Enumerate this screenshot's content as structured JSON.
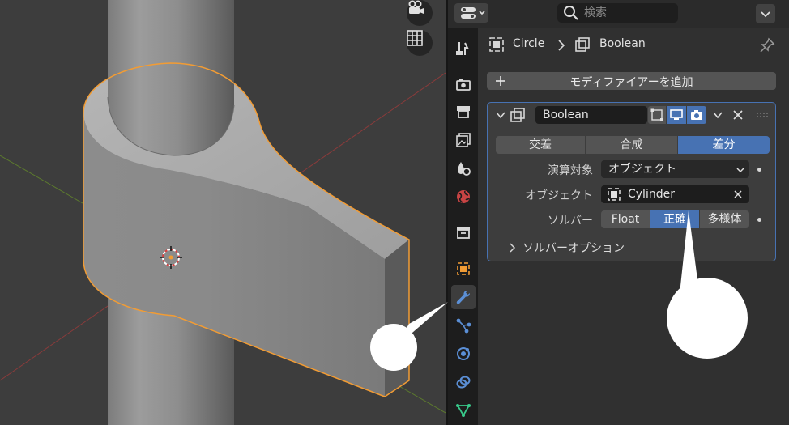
{
  "header": {
    "search_placeholder": "検索"
  },
  "breadcrumb": {
    "object": "Circle",
    "modifier": "Boolean"
  },
  "add_modifier_label": "モディファイアーを追加",
  "modifier": {
    "name": "Boolean",
    "operations": [
      "交差",
      "合成",
      "差分"
    ],
    "selected_operation": "差分",
    "operand_label": "演算対象",
    "operand_value": "オブジェクト",
    "object_label": "オブジェクト",
    "object_value": "Cylinder",
    "solver_label": "ソルバー",
    "solver_options": [
      "Float",
      "正確",
      "多様体"
    ],
    "selected_solver": "正確",
    "solver_options_panel": "ソルバーオプション"
  },
  "properties_tabs": [
    "tool",
    "render",
    "output",
    "view-layer",
    "scene",
    "world",
    "collection",
    "object",
    "modifiers",
    "particles",
    "physics",
    "constraints",
    "data"
  ],
  "active_tab": "modifiers",
  "colors": {
    "accent": "#4772b3",
    "selection_outline": "#f29c34",
    "panel_bg": "#303030",
    "viewport_bg": "#3d3d3d"
  }
}
